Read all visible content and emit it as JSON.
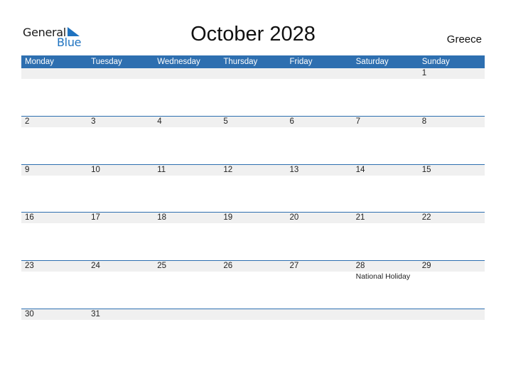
{
  "logo": {
    "general": "General",
    "blue": "Blue"
  },
  "title": "October 2028",
  "country": "Greece",
  "weekdays": [
    "Monday",
    "Tuesday",
    "Wednesday",
    "Thursday",
    "Friday",
    "Saturday",
    "Sunday"
  ],
  "weeks": [
    {
      "days": [
        "",
        "",
        "",
        "",
        "",
        "",
        "1"
      ],
      "events": [
        "",
        "",
        "",
        "",
        "",
        "",
        ""
      ]
    },
    {
      "days": [
        "2",
        "3",
        "4",
        "5",
        "6",
        "7",
        "8"
      ],
      "events": [
        "",
        "",
        "",
        "",
        "",
        "",
        ""
      ]
    },
    {
      "days": [
        "9",
        "10",
        "11",
        "12",
        "13",
        "14",
        "15"
      ],
      "events": [
        "",
        "",
        "",
        "",
        "",
        "",
        ""
      ]
    },
    {
      "days": [
        "16",
        "17",
        "18",
        "19",
        "20",
        "21",
        "22"
      ],
      "events": [
        "",
        "",
        "",
        "",
        "",
        "",
        ""
      ]
    },
    {
      "days": [
        "23",
        "24",
        "25",
        "26",
        "27",
        "28",
        "29"
      ],
      "events": [
        "",
        "",
        "",
        "",
        "",
        "National Holiday",
        ""
      ]
    },
    {
      "days": [
        "30",
        "31",
        "",
        "",
        "",
        "",
        ""
      ],
      "events": [
        "",
        "",
        "",
        "",
        "",
        "",
        ""
      ]
    }
  ],
  "colors": {
    "accent": "#2e6fb0",
    "strip": "#f0f0f0",
    "logo_blue": "#1f73c0"
  }
}
